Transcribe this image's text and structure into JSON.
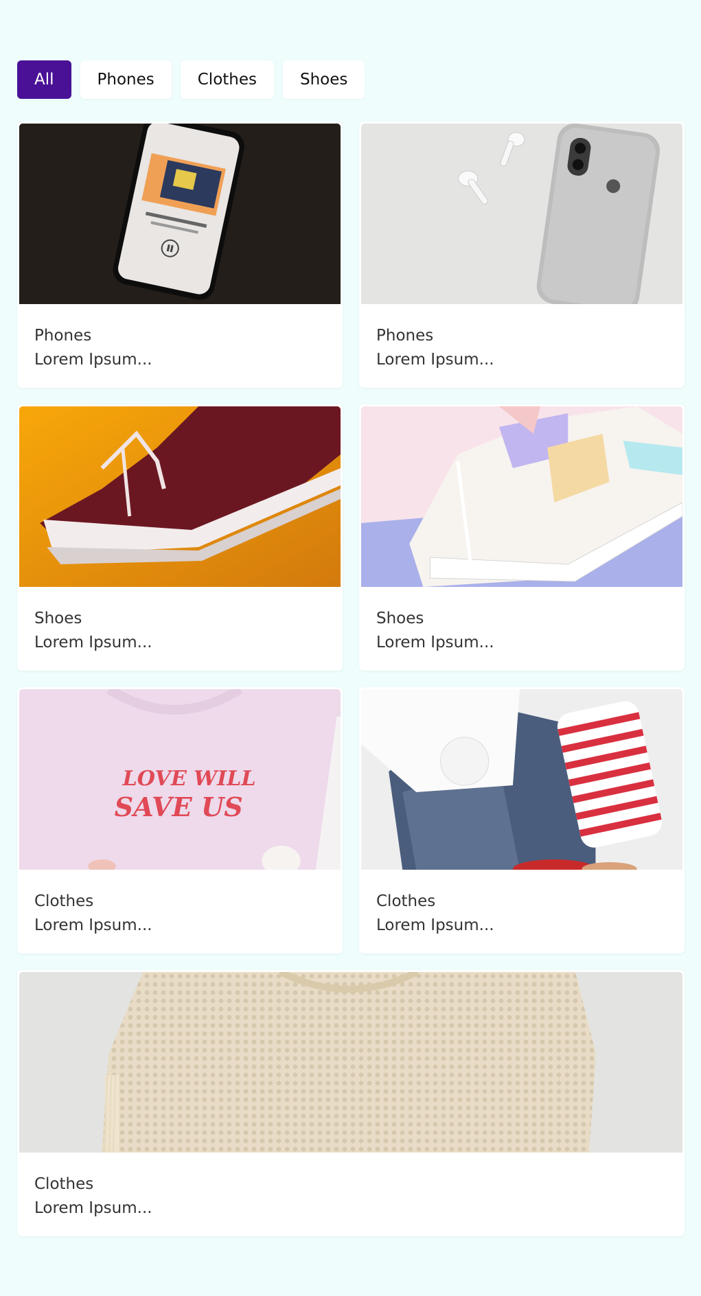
{
  "filters": [
    {
      "label": "All",
      "active": true
    },
    {
      "label": "Phones",
      "active": false
    },
    {
      "label": "Clothes",
      "active": false
    },
    {
      "label": "Shoes",
      "active": false
    }
  ],
  "colors": {
    "page_bg": "#effefd",
    "accent": "#4a1196",
    "card_bg": "#ffffff",
    "text": "#333333"
  },
  "cards": [
    {
      "category": "Phones",
      "description": "Lorem Ipsum...",
      "image": "phone-music-app-image"
    },
    {
      "category": "Phones",
      "description": "Lorem Ipsum...",
      "image": "iphone-airpods-image"
    },
    {
      "category": "Shoes",
      "description": "Lorem Ipsum...",
      "image": "burgundy-sneaker-image"
    },
    {
      "category": "Shoes",
      "description": "Lorem Ipsum...",
      "image": "pastel-sneaker-image"
    },
    {
      "category": "Clothes",
      "description": "Lorem Ipsum...",
      "image": "pink-tshirt-image",
      "image_text": [
        "LOVE WILL",
        "SAVE US"
      ]
    },
    {
      "category": "Clothes",
      "description": "Lorem Ipsum...",
      "image": "denim-striped-clothes-image"
    },
    {
      "category": "Clothes",
      "description": "Lorem Ipsum...",
      "image": "knit-sweater-image"
    }
  ]
}
